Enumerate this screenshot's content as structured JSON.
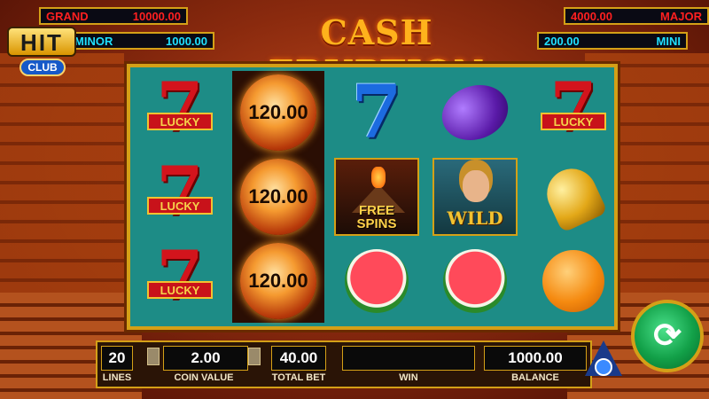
{
  "game": {
    "title": "CASH ERUPTION"
  },
  "logo": {
    "brand": "HIT",
    "sub": "CLUB"
  },
  "jackpots": {
    "grand": {
      "name": "GRAND",
      "value": "10000.00"
    },
    "minor": {
      "name": "MINOR",
      "value": "1000.00"
    },
    "major": {
      "name": "MAJOR",
      "value": "4000.00"
    },
    "mini": {
      "name": "MINI",
      "value": "200.00"
    }
  },
  "reels": {
    "reel1": [
      "lucky-seven",
      "lucky-seven",
      "lucky-seven"
    ],
    "reel2": [
      "cash-fireball",
      "cash-fireball",
      "cash-fireball"
    ],
    "reel3": [
      "blue-seven",
      "free-spins-volcano",
      "watermelon"
    ],
    "reel4": [
      "plum",
      "wild-goddess",
      "watermelon"
    ],
    "reel5": [
      "lucky-seven",
      "bell",
      "orange"
    ]
  },
  "symbols": {
    "lucky_label": "LUCKY",
    "seven": "7",
    "fireball_value": "120.00",
    "free_spins_line1": "FREE",
    "free_spins_line2": "SPINS",
    "wild_label": "WILD"
  },
  "bottom_bar": {
    "lines": {
      "value": "20",
      "label": "LINES"
    },
    "coin_value": {
      "value": "2.00",
      "label": "COIN VALUE"
    },
    "total_bet": {
      "value": "40.00",
      "label": "TOTAL BET"
    },
    "win": {
      "value": "",
      "label": "WIN"
    },
    "balance": {
      "value": "1000.00",
      "label": "BALANCE"
    }
  },
  "spin_button": {
    "icon": "refresh-icon",
    "glyph": "⟳"
  },
  "colors": {
    "reel_bg": "#1d8c86",
    "gold": "#d4a017",
    "grand_text": "#ff2020",
    "minor_text": "#20e0ff"
  }
}
